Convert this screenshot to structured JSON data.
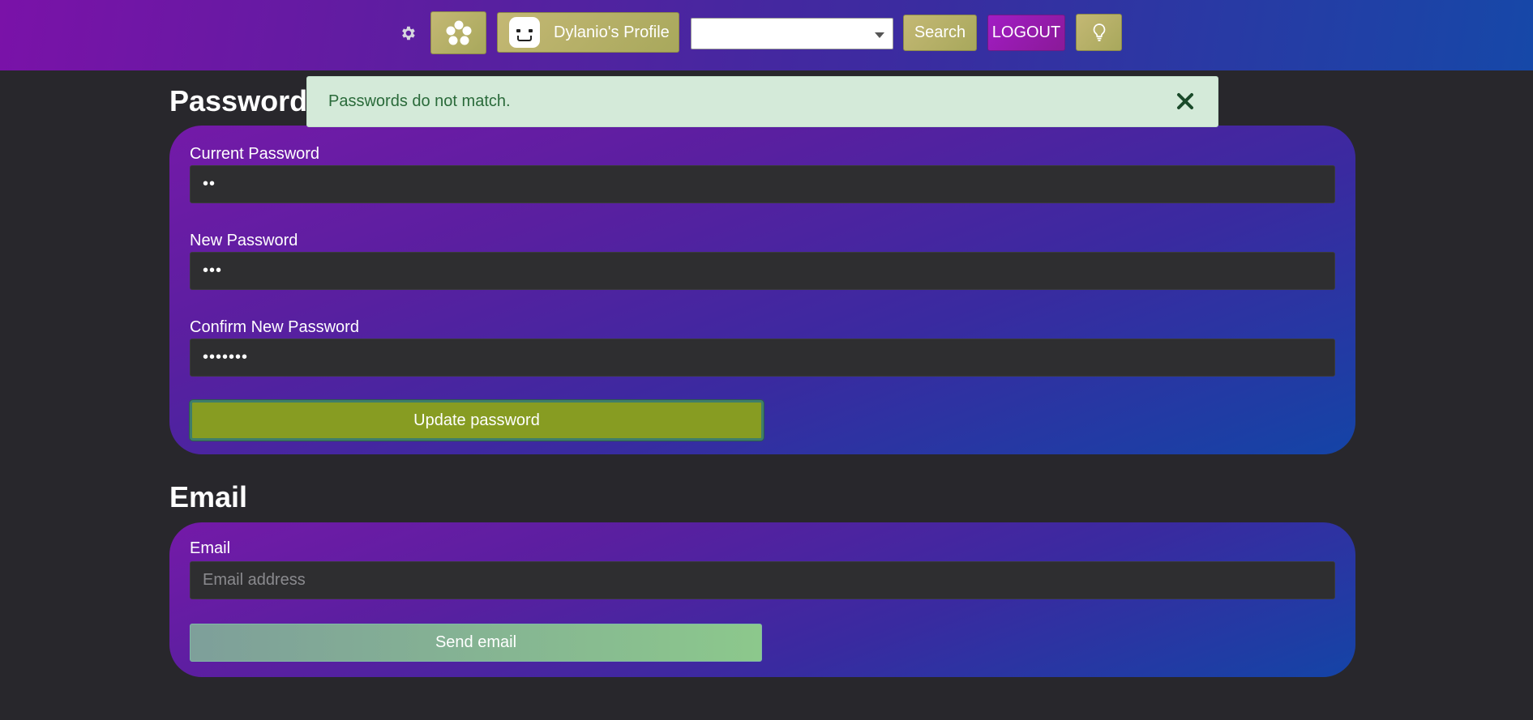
{
  "nav": {
    "settings_icon": "gear-icon",
    "home_icon": "flower-icon",
    "profile_label": "Dylanio's Profile",
    "profile_avatar_icon": "face-avatar-icon",
    "search_select_value": "",
    "search_label": "Search",
    "logout_label": "LOGOUT",
    "theme_icon": "lightbulb-icon",
    "colors": {
      "nav_gradient_start": "#7a12a8",
      "nav_gradient_end": "#1648a8",
      "olive_button": "#b8b068",
      "logout_button": "#a21cc4"
    }
  },
  "alert": {
    "message": "Passwords do not match.",
    "close_icon": "close-icon",
    "color": "#d4ead9"
  },
  "password_section": {
    "title": "Password",
    "current_label": "Current Password",
    "current_value": "••",
    "new_label": "New Password",
    "new_value": "•••",
    "confirm_label": "Confirm New Password",
    "confirm_value": "•••••••",
    "update_button": "Update password"
  },
  "email_section": {
    "title": "Email",
    "email_label": "Email",
    "email_placeholder": "Email address",
    "email_value": "",
    "send_button": "Send email"
  }
}
